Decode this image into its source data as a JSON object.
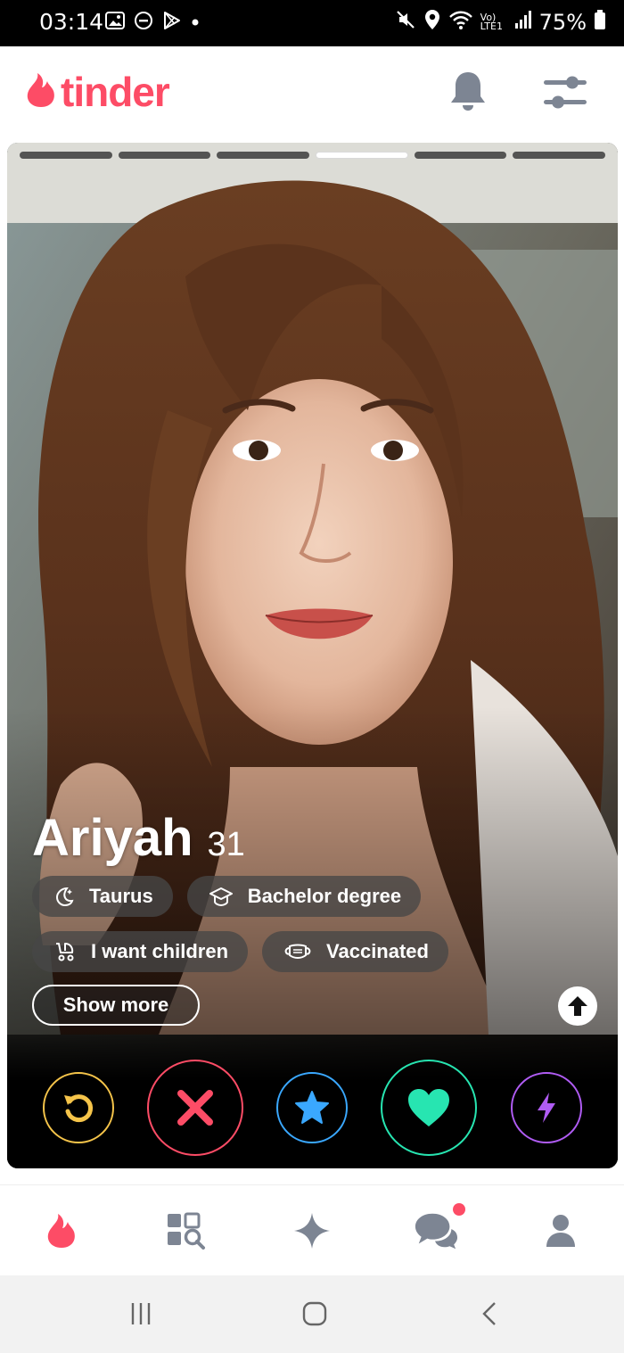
{
  "status_bar": {
    "time": "03:14",
    "network": "Vo) LTE1",
    "battery": "75%"
  },
  "header": {
    "logo_text": "tinder"
  },
  "profile": {
    "name": "Ariyah",
    "age": "31",
    "photo_index": 4,
    "photo_count": 6,
    "chips": [
      {
        "icon": "moon-icon",
        "label": "Taurus"
      },
      {
        "icon": "graduation-cap-icon",
        "label": "Bachelor degree"
      },
      {
        "icon": "baby-stroller-icon",
        "label": "I want children"
      },
      {
        "icon": "mask-icon",
        "label": "Vaccinated"
      }
    ],
    "show_more_label": "Show more"
  },
  "actions": [
    "rewind-icon",
    "nope-x-icon",
    "super-like-star-icon",
    "like-heart-icon",
    "boost-bolt-icon"
  ],
  "colors": {
    "brand": "#fd4c66",
    "rewind": "#f5c44a",
    "super_like": "#3aa8ff",
    "like": "#27e5b1",
    "boost": "#b05cf4"
  },
  "bottom_nav": [
    "flame-icon",
    "explore-icon",
    "sparkle-icon",
    "chat-icon",
    "profile-icon"
  ]
}
